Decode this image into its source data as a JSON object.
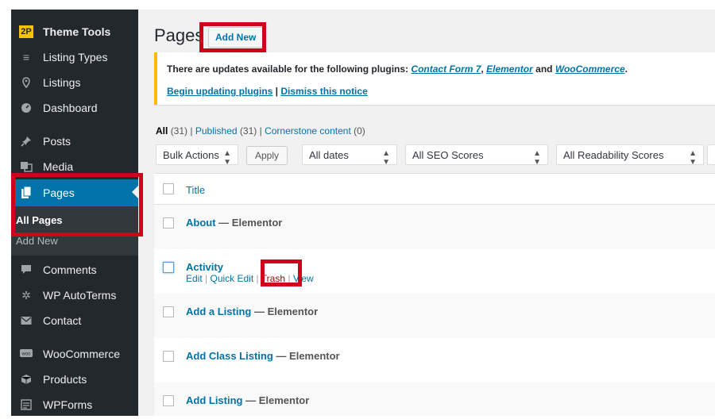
{
  "sidebar": {
    "brand": {
      "logo": "2P",
      "label": "Theme Tools"
    },
    "items": [
      {
        "label": "Listing Types",
        "icon": "list-icon"
      },
      {
        "label": "Listings",
        "icon": "pin-icon"
      },
      {
        "label": "Dashboard",
        "icon": "dashboard-icon"
      },
      {
        "label": "Posts",
        "icon": "pin-thumbtack-icon"
      },
      {
        "label": "Media",
        "icon": "media-icon"
      },
      {
        "label": "Pages",
        "icon": "pages-icon",
        "active": true
      },
      {
        "label": "Comments",
        "icon": "comment-icon"
      },
      {
        "label": "WP AutoTerms",
        "icon": "gear-icon"
      },
      {
        "label": "Contact",
        "icon": "mail-icon"
      },
      {
        "label": "WooCommerce",
        "icon": "woo-icon"
      },
      {
        "label": "Products",
        "icon": "box-icon"
      },
      {
        "label": "WPForms",
        "icon": "form-icon"
      }
    ],
    "submenu": {
      "all_pages": "All Pages",
      "add_new": "Add New"
    }
  },
  "header": {
    "title": "Pages",
    "add_new": "Add New"
  },
  "notice": {
    "text": "There are updates available for the following plugins:",
    "plugin1": "Contact Form 7",
    "sep1": ",",
    "plugin2": "Elementor",
    "and": "and",
    "plugin3": "WooCommerce",
    "end": ".",
    "begin": "Begin updating plugins",
    "pipe": "|",
    "dismiss": "Dismiss this notice"
  },
  "views": {
    "all": "All",
    "all_count": "(31)",
    "published": "Published",
    "published_count": "(31)",
    "cornerstone": "Cornerstone content",
    "cornerstone_count": "(0)",
    "sep": "|"
  },
  "filters": {
    "bulk": "Bulk Actions",
    "apply": "Apply",
    "dates": "All dates",
    "seo": "All SEO Scores",
    "readability": "All Readability Scores"
  },
  "table": {
    "header_title": "Title",
    "rows": [
      {
        "title": "About",
        "state": "— Elementor"
      },
      {
        "title": "Activity",
        "state": ""
      },
      {
        "title": "Add a Listing",
        "state": "— Elementor"
      },
      {
        "title": "Add Class Listing",
        "state": "— Elementor"
      },
      {
        "title": "Add Listing",
        "state": "— Elementor"
      }
    ],
    "row_actions": {
      "edit": "Edit",
      "quick_edit": "Quick Edit",
      "trash": "Trash",
      "view": "View",
      "sep": "|"
    }
  },
  "colors": {
    "highlight": "#d0021b",
    "accent": "#0073aa",
    "sidebar": "#23282d",
    "notice_border": "#ffb900"
  }
}
